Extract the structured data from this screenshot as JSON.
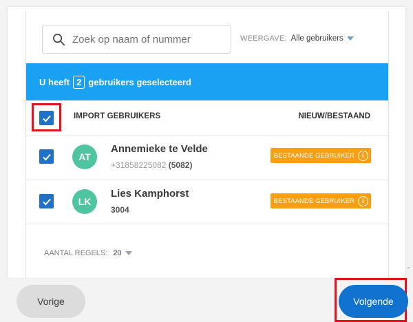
{
  "search": {
    "placeholder": "Zoek op naam of nummer"
  },
  "view": {
    "label": "WEERGAVE:",
    "selected": "Alle gebruikers"
  },
  "banner": {
    "prefix": "U heeft",
    "count": "2",
    "suffix": "gebruikers geselecteerd"
  },
  "table": {
    "header_label": "IMPORT GEBRUIKERS",
    "header_right": "NIEUW/BESTAAND",
    "rows": [
      {
        "initials": "AT",
        "name": "Annemieke te Velde",
        "number": "+31858225082",
        "extension": "(5082)",
        "status": "BESTAANDE GEBRUIKER"
      },
      {
        "initials": "LK",
        "name": "Lies Kamphorst",
        "number": "3004",
        "extension": "",
        "status": "BESTAANDE GEBRUIKER"
      }
    ]
  },
  "pagination": {
    "label": "AANTAL REGELS:",
    "value": "20"
  },
  "footer": {
    "prev_label": "Vorige",
    "next_label": "Volgende"
  },
  "colors": {
    "accent": "#1aa1f3",
    "checkbox": "#1f72c6",
    "badge": "#fb9f12",
    "avatar": "#4ec4a1",
    "primary_button": "#1173cf",
    "highlight": "#e0141e"
  }
}
